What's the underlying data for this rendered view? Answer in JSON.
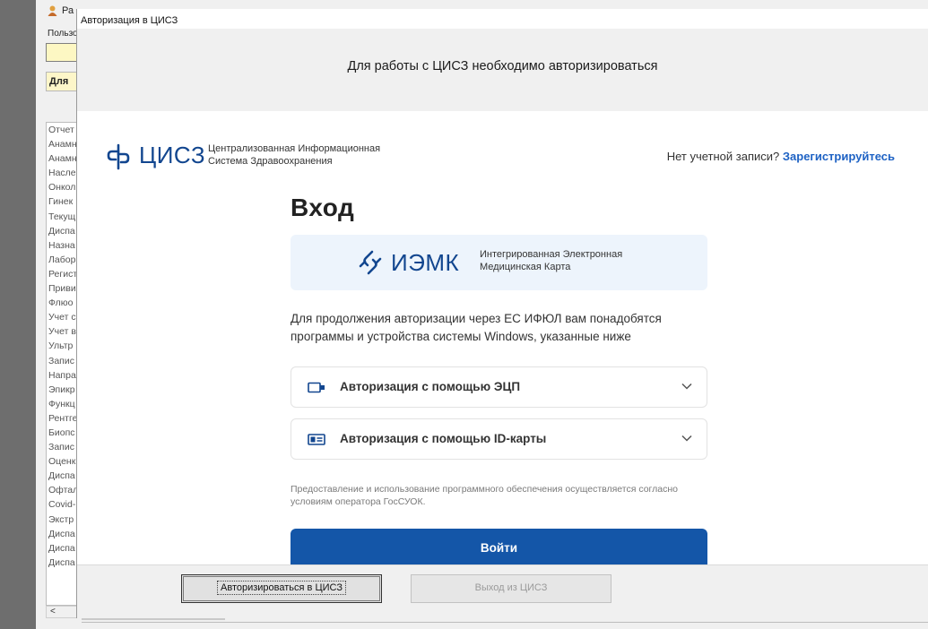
{
  "background_app": {
    "title_fragment": "Ра",
    "user_label": "Пользо",
    "for_button": "Для",
    "list_items": [
      "Отчет",
      "Анамн",
      "Анамн",
      "Насле",
      "Онкол",
      "Гинек",
      "Текущ",
      "Диспа",
      "Назна",
      "Лабор",
      "Регист",
      "Приви",
      "Флюо",
      "Учет с",
      "Учет в",
      "Ультр",
      "Запис",
      "Напра",
      "Эпикр",
      "Функц",
      "Рентге",
      "Биопс",
      "Запис",
      "Оценк",
      "Диспа",
      "Офтал",
      "Covid-",
      "Экстр",
      "Диспа",
      "Диспа",
      "Диспа"
    ],
    "scroll_left": "<"
  },
  "dialog": {
    "title": "Авторизация в ЦИСЗ",
    "banner": "Для работы с ЦИСЗ необходимо авторизироваться"
  },
  "header": {
    "logo_text": "ЦИСЗ",
    "subtitle_line1": "Централизованная Информационная",
    "subtitle_line2": "Система Здравоохранения",
    "no_account": "Нет учетной записи?",
    "register_link": "Зарегистрируйтесь"
  },
  "login": {
    "heading": "Вход",
    "iemk_text": "ИЭМК",
    "iemk_sub_line1": "Интегрированная Электронная",
    "iemk_sub_line2": "Медицинская Карта",
    "instruction": "Для продолжения авторизации через ЕС ИФЮЛ вам понадобятся программы и устройства системы Windows, указанные ниже",
    "options": [
      {
        "label": "Авторизация с помощью ЭЦП",
        "icon": "usb-token-icon"
      },
      {
        "label": "Авторизация с помощью ID-карты",
        "icon": "id-card-icon"
      }
    ],
    "disclaimer": "Предоставление и использование программного обеспечения осуществляется согласно условиям оператора ГосСУОК.",
    "login_button": "Войти"
  },
  "footer": {
    "auth_button": "Авторизироваться в ЦИСЗ",
    "exit_button": "Выход из ЦИСЗ"
  },
  "colors": {
    "brand_blue": "#12468f",
    "button_blue": "#1456a8",
    "link_blue": "#1e62c4",
    "card_bg": "#edf4fc"
  }
}
